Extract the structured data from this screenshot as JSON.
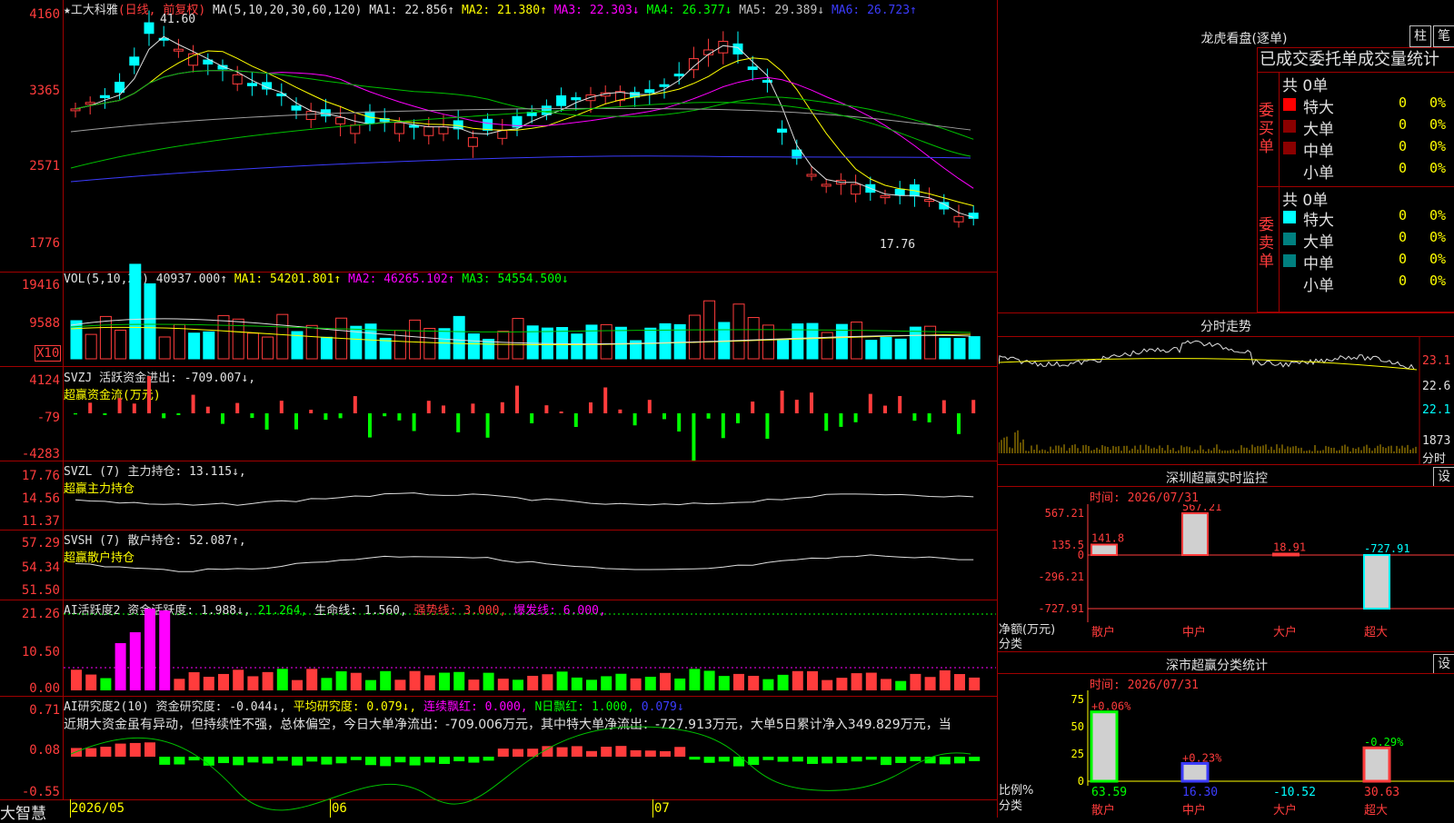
{
  "main_header": {
    "star": "★",
    "name": "工大科雅",
    "period": "(日线, 前复权)",
    "ma": "MA(5,10,20,30,60,120)",
    "ma1": "MA1: 22.856↑",
    "ma2": "MA2: 21.380↑",
    "ma3": "MA3: 22.303↓",
    "ma4": "MA4: 26.377↓",
    "ma5": "MA5: 29.389↓",
    "ma6": "MA6: 26.723↑",
    "high_label": "41.60",
    "low_label": "17.76"
  },
  "vol_header": {
    "name": "VOL(5,10,20)",
    "v": "40937.000↑",
    "ma1": "MA1: 54201.801↑",
    "ma2": "MA2: 46265.102↑",
    "ma3": "MA3: 54554.500↓",
    "x10": "X10"
  },
  "svzj_header": {
    "name": "SVZJ",
    "text": "活跃资金进出: -709.007↓,",
    "sub": "超赢资金流(万元)"
  },
  "svzl_header": {
    "name": "SVZL (7)",
    "text": "主力持仓: 13.115↓,",
    "sub": "超赢主力持仓"
  },
  "svsh_header": {
    "name": "SVSH (7)",
    "text": "散户持仓: 52.087↑,",
    "sub": "超赢散户持仓"
  },
  "ai1_header": {
    "name": "AI活跃度2",
    "a": "资金活跃度: 1.988↓,",
    "b": "21.264,",
    "c": "生命线: 1.560,",
    "d": "强势线: 3.000,",
    "e": "爆发线: 6.000,"
  },
  "ai2_header": {
    "name": "AI研究度2(10)",
    "a": "资金研究度: -0.044↓,",
    "b": "平均研究度: 0.079↓,",
    "c": "连续飘红: 0.000,",
    "d": "N日飘红: 1.000,",
    "e": "0.079↓"
  },
  "ai2_text": "近期大资金虽有异动，但持续性不强，总体偏空，今日大单净流出：-709.006万元，其中特大单净流出：-727.913万元，大单5日累计净入349.829万元，当",
  "y_labels": {
    "main": [
      "4160",
      "3365",
      "2571",
      "1776"
    ],
    "vol": [
      "19416",
      "9588"
    ],
    "svzj": [
      "4124",
      "-79",
      "-4283"
    ],
    "svzl": [
      "17.76",
      "14.56",
      "11.37"
    ],
    "svsh": [
      "57.29",
      "54.34",
      "51.50"
    ],
    "ai1": [
      "21.26",
      "10.50",
      "0.00"
    ],
    "ai2": [
      "0.71",
      "0.08",
      "-0.55"
    ]
  },
  "x_labels": {
    "left": "大智慧",
    "m1": "2026/05",
    "m2": "06",
    "m3": "07"
  },
  "right": {
    "lhb_title": "龙虎看盘(逐单)",
    "btn_zhu": "柱",
    "btn_bi": "笔",
    "stat_title": "已成交委托单成交量统计",
    "buy_label": "委买单",
    "sell_label": "委卖单",
    "buy_total": "共 0单",
    "sell_total": "共 0单",
    "rows": [
      "特大",
      "大单",
      "中单",
      "小单"
    ],
    "zero": "0",
    "pct": "0%",
    "buy_colors": [
      "#ff0000",
      "#8b0000",
      "#8b0000",
      "#000000"
    ],
    "sell_colors": [
      "#00ffff",
      "#008080",
      "#008080",
      "#000000"
    ],
    "fs_title": "分时走势",
    "fs_prices": [
      "23.1",
      "22.6",
      "22.1"
    ],
    "fs_vol": "1873",
    "fs_label": "分时",
    "sz_title": "深圳超赢实时监控",
    "sz_btn": "设",
    "sz_time": "时间: 2026/07/31",
    "sz_y": [
      "567.21",
      "135.5",
      "0",
      "-296.21",
      "-727.91"
    ],
    "sz_ylabel": "净额(万元)",
    "sz_xlabel": "分类",
    "cat": [
      "散户",
      "中户",
      "大户",
      "超大"
    ],
    "sz_vals_text": [
      "141.8",
      "567.21",
      "18.91",
      "-727.91"
    ],
    "cls_title": "深市超赢分类统计",
    "cls_btn": "设",
    "cls_time": "时间: 2026/07/31",
    "cls_y": [
      "75",
      "50",
      "25",
      "0"
    ],
    "cls_ylabel": "比例%",
    "cls_xlabel": "分类",
    "cls_pct": [
      "+0.06%",
      "+0.23%",
      "",
      "-0.29%"
    ],
    "cls_vals": [
      "63.59",
      "16.30",
      "-10.52",
      "30.63"
    ]
  },
  "chart_data": [
    {
      "type": "bar",
      "title": "深圳超赢实时监控",
      "categories": [
        "散户",
        "中户",
        "大户",
        "超大"
      ],
      "values": [
        141.8,
        567.21,
        18.91,
        -727.91
      ],
      "ylabel": "净额(万元)",
      "ylim": [
        -727.91,
        567.21
      ]
    },
    {
      "type": "bar",
      "title": "深市超赢分类统计",
      "categories": [
        "散户",
        "中户",
        "大户",
        "超大"
      ],
      "values": [
        63.59,
        16.3,
        -10.52,
        30.63
      ],
      "ylabel": "比例%",
      "ylim": [
        0,
        75
      ]
    }
  ],
  "colors": {
    "up": "#ff3c3c",
    "down": "#00ffff",
    "grid": "#a00000"
  }
}
